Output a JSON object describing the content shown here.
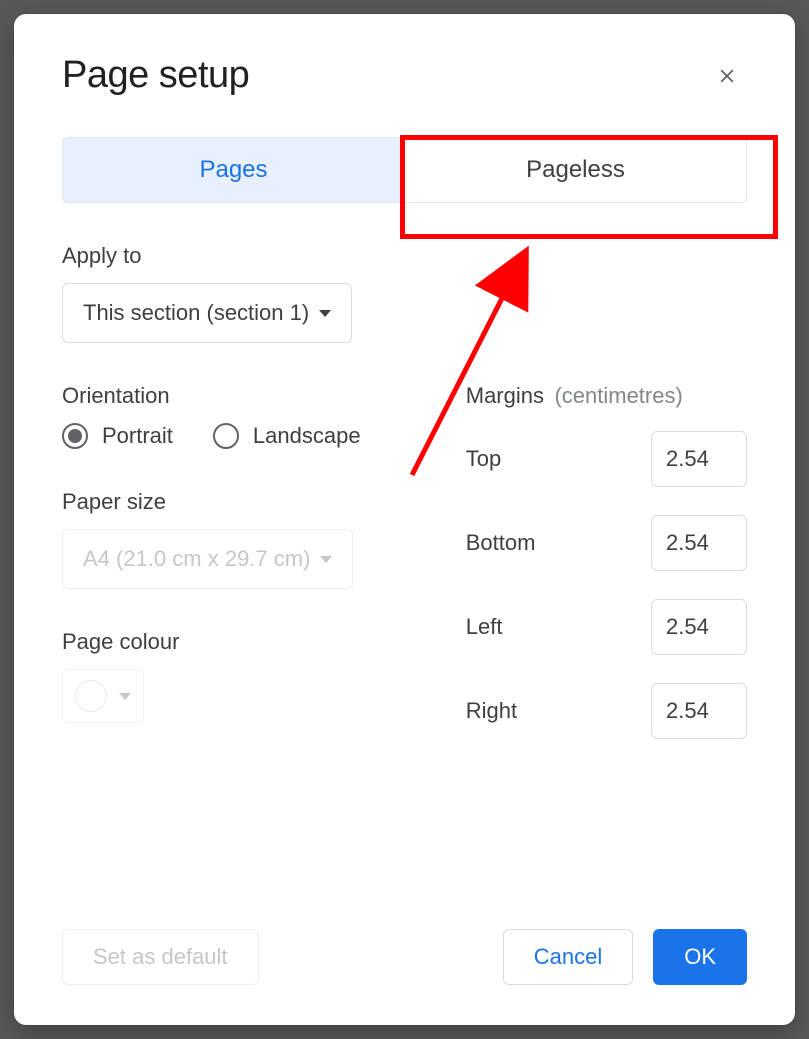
{
  "dialog": {
    "title": "Page setup"
  },
  "tabs": {
    "pages": "Pages",
    "pageless": "Pageless"
  },
  "applyTo": {
    "label": "Apply to",
    "value": "This section (section 1)"
  },
  "orientation": {
    "label": "Orientation",
    "portrait": "Portrait",
    "landscape": "Landscape"
  },
  "paperSize": {
    "label": "Paper size",
    "value": "A4 (21.0 cm x 29.7 cm)"
  },
  "pageColour": {
    "label": "Page colour"
  },
  "margins": {
    "label": "Margins",
    "units": "(centimetres)",
    "top_label": "Top",
    "bottom_label": "Bottom",
    "left_label": "Left",
    "right_label": "Right",
    "top": "2.54",
    "bottom": "2.54",
    "left": "2.54",
    "right": "2.54"
  },
  "buttons": {
    "set_default": "Set as default",
    "cancel": "Cancel",
    "ok": "OK"
  }
}
